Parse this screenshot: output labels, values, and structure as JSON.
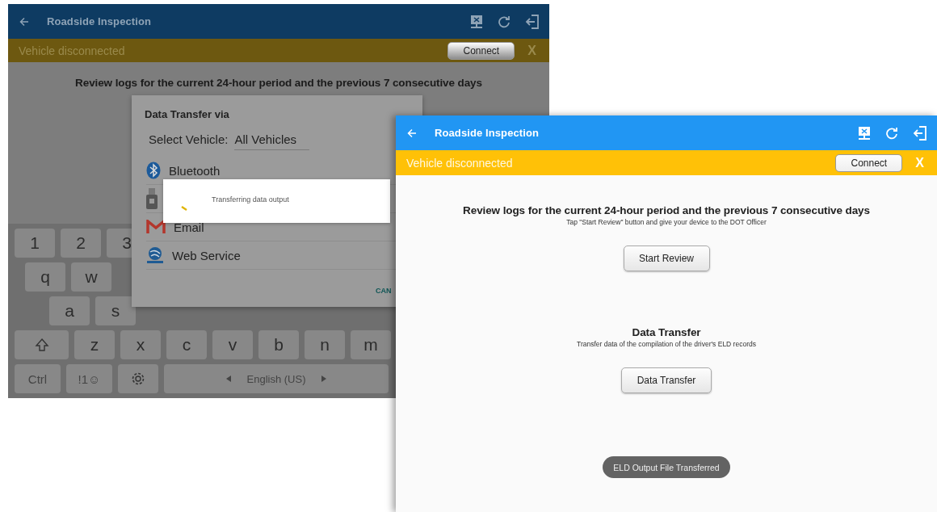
{
  "back_screen": {
    "app_bar": {
      "title": "Roadside Inspection"
    },
    "banner": {
      "text": "Vehicle disconnected",
      "button": "Connect",
      "close": "X"
    },
    "sections": [
      {
        "title": "Review logs for the current 24-hour period and the previous 7 consecutive days"
      }
    ],
    "dialog": {
      "title": "Data Transfer via",
      "select_label": "Select Vehicle:",
      "select_value": "All Vehicles",
      "options": [
        {
          "kind": "bluetooth",
          "label": "Bluetooth"
        },
        {
          "kind": "usb"
        },
        {
          "kind": "email",
          "label": "Email"
        },
        {
          "kind": "web",
          "label": "Web Service"
        }
      ],
      "cancel": "CAN"
    },
    "progress": {
      "text": "Transferring data output"
    },
    "keyboard": {
      "key_rows": [
        [
          {
            "kind": "key",
            "label": "1"
          },
          {
            "kind": "key",
            "label": "2"
          },
          {
            "kind": "key",
            "label": "3"
          }
        ],
        [
          {
            "kind": "key",
            "label": "q"
          },
          {
            "kind": "key",
            "label": "w"
          }
        ],
        [
          {
            "kind": "key",
            "label": "a"
          },
          {
            "kind": "key",
            "label": "s"
          }
        ],
        [
          {
            "kind": "shift"
          },
          {
            "kind": "key",
            "label": "z"
          },
          {
            "kind": "key",
            "label": "x"
          },
          {
            "kind": "key",
            "label": "c"
          },
          {
            "kind": "key",
            "label": "v"
          },
          {
            "kind": "key",
            "label": "b"
          },
          {
            "kind": "key",
            "label": "n"
          },
          {
            "kind": "key",
            "label": "m"
          }
        ],
        [
          {
            "kind": "function",
            "label": "Ctrl"
          },
          {
            "kind": "function",
            "label": "!1☺"
          },
          {
            "kind": "settings"
          },
          {
            "kind": "space",
            "label": "English (US)"
          }
        ]
      ]
    }
  },
  "front_screen": {
    "app_bar": {
      "title": "Roadside Inspection"
    },
    "banner": {
      "text": "Vehicle disconnected",
      "button": "Connect",
      "close": "X"
    },
    "sections": [
      {
        "title": "Review logs for the current 24-hour period and the previous 7 consecutive days",
        "subtitle": "Tap \"Start Review\" button and give your device to the DOT Officer",
        "button": "Start Review"
      },
      {
        "title": "Data Transfer",
        "subtitle": "Transfer data of the compilation of the driver's ELD records",
        "button": "Data Transfer"
      }
    ],
    "toast": "ELD Output File Transferred"
  }
}
